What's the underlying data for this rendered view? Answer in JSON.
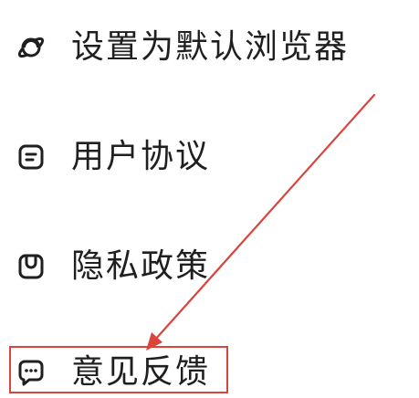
{
  "menu": {
    "items": [
      {
        "label": "设置为默认浏览器",
        "icon": "planet-icon"
      },
      {
        "label": "用户协议",
        "icon": "document-icon"
      },
      {
        "label": "隐私政策",
        "icon": "privacy-icon"
      },
      {
        "label": "意见反馈",
        "icon": "feedback-chat-icon"
      }
    ]
  },
  "annotation": {
    "highlight_color": "#d9443d",
    "highlighted_item": "意见反馈"
  }
}
